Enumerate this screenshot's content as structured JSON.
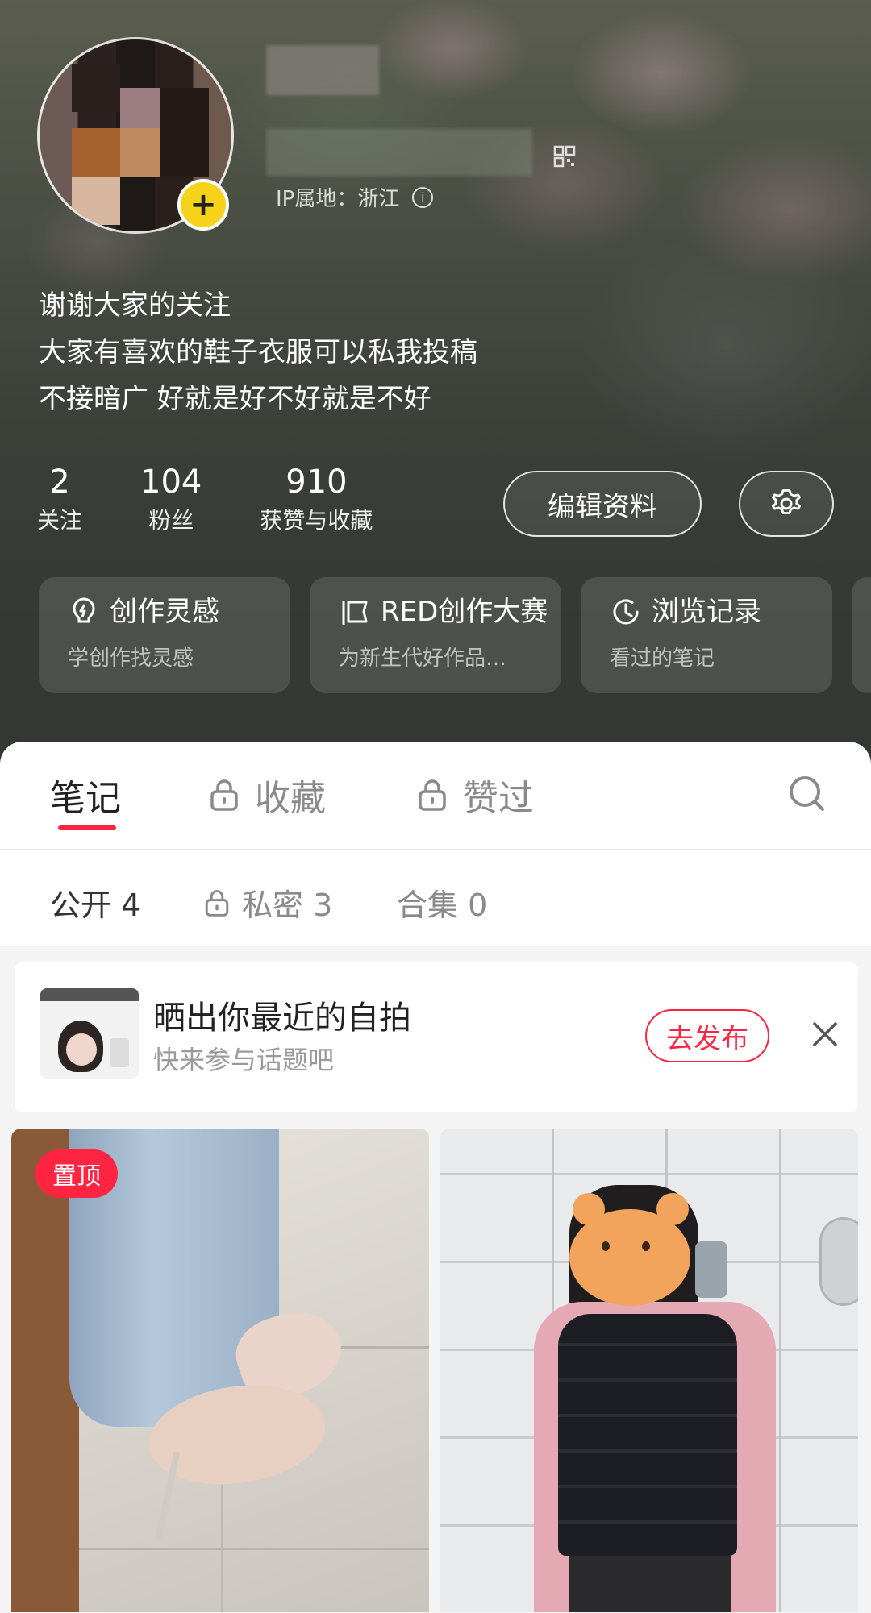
{
  "profile": {
    "ip_label": "IP属地：浙江",
    "bio": [
      "谢谢大家的关注",
      "大家有喜欢的鞋子衣服可以私我投稿",
      "不接暗广 好就是好不好就是不好"
    ],
    "stats": [
      {
        "value": "2",
        "label": "关注"
      },
      {
        "value": "104",
        "label": "粉丝"
      },
      {
        "value": "910",
        "label": "获赞与收藏"
      }
    ],
    "edit_label": "编辑资料"
  },
  "cards": [
    {
      "title": "创作灵感",
      "subtitle": "学创作找灵感",
      "icon": "bulb-icon"
    },
    {
      "title": "RED创作大赛",
      "subtitle": "为新生代好作品…",
      "icon": "flag-icon"
    },
    {
      "title": "浏览记录",
      "subtitle": "看过的笔记",
      "icon": "clock-icon"
    }
  ],
  "tabs": [
    {
      "label": "笔记",
      "locked": false,
      "active": true
    },
    {
      "label": "收藏",
      "locked": true,
      "active": false
    },
    {
      "label": "赞过",
      "locked": true,
      "active": false
    }
  ],
  "subtabs": [
    {
      "label": "公开 4",
      "locked": false,
      "active": true
    },
    {
      "label": "私密 3",
      "locked": true,
      "active": false
    },
    {
      "label": "合集 0",
      "locked": false,
      "active": false
    }
  ],
  "topic": {
    "title": "晒出你最近的自拍",
    "subtitle": "快来参与话题吧",
    "button": "去发布"
  },
  "notes": [
    {
      "pinned_label": "置顶"
    }
  ],
  "colors": {
    "accent": "#ff2442",
    "add_badge": "#f6d31a"
  }
}
